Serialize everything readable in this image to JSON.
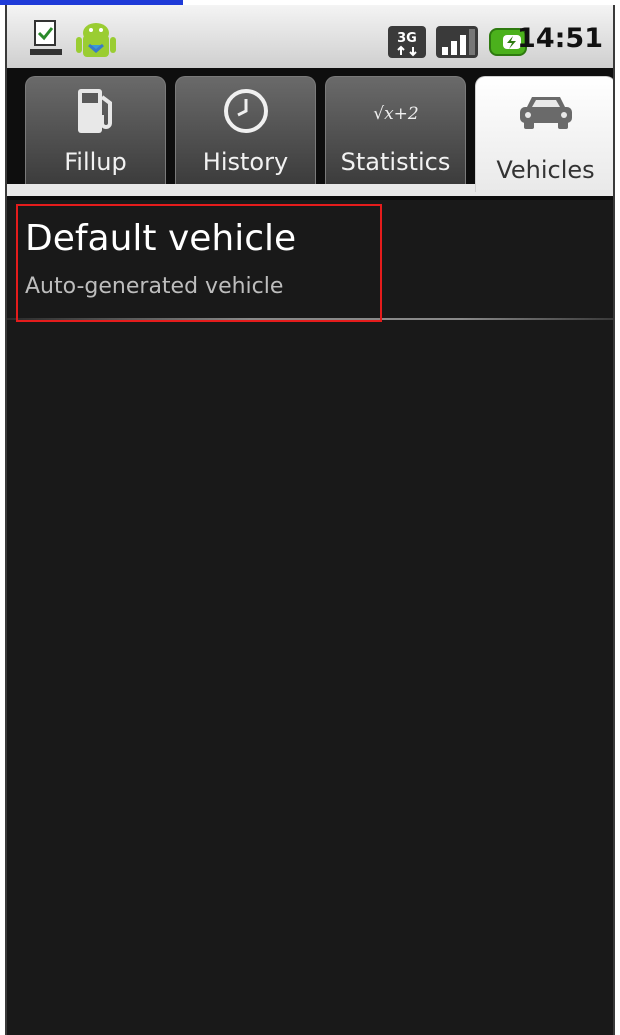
{
  "status_bar": {
    "time": "14:51",
    "network_type": "3G",
    "icons": [
      "download-doc-icon",
      "android-debug-icon",
      "network-3g-icon",
      "signal-strength-icon",
      "battery-charging-icon"
    ]
  },
  "tabs": [
    {
      "label": "Fillup",
      "icon": "fuel-pump-icon",
      "selected": false
    },
    {
      "label": "History",
      "icon": "clock-icon",
      "selected": false
    },
    {
      "label": "Statistics",
      "icon": "formula-icon",
      "icon_text": "√x+2",
      "selected": false
    },
    {
      "label": "Vehicles",
      "icon": "car-icon",
      "selected": true
    }
  ],
  "vehicles": [
    {
      "name": "Default vehicle",
      "description": "Auto-generated vehicle"
    }
  ],
  "colors": {
    "background": "#191919",
    "highlight": "#e41c1c",
    "selected_tab": "#ffffff"
  }
}
